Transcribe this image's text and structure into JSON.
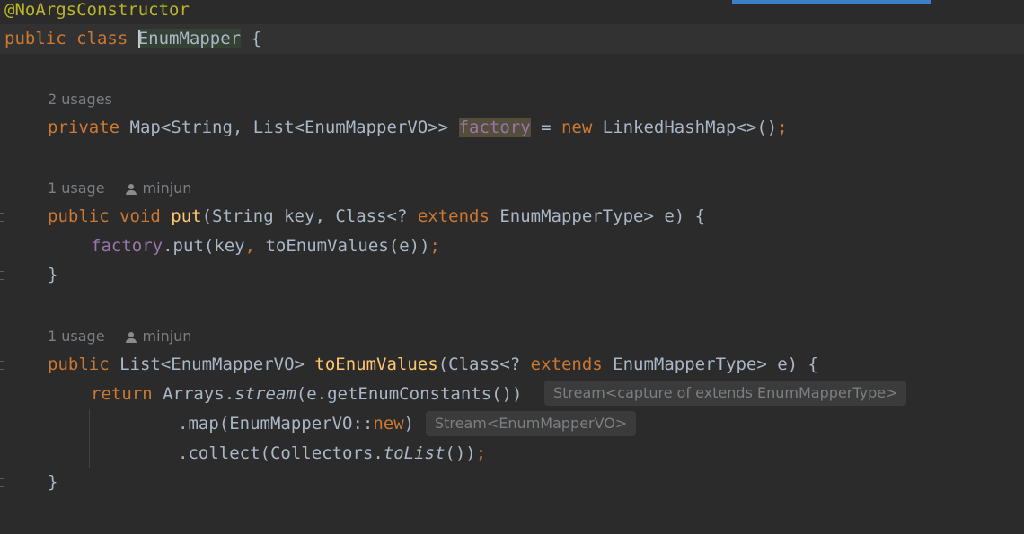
{
  "editor": {
    "colors": {
      "background": "#2b2b2b",
      "text": "#a9b7c6",
      "keyword": "#cc7832",
      "annotation": "#bbb529",
      "field": "#9876aa",
      "method": "#ffc66d",
      "hint": "#7c7f82"
    },
    "annotation": "@NoArgsConstructor",
    "class_decl": {
      "kw": "public class ",
      "name": "EnumMapper",
      "brace": " {"
    },
    "field_usage": "2 usages",
    "field_decl": {
      "kw1": "private ",
      "type": "Map<String, List<EnumMapperVO>> ",
      "name": "factory",
      "assign": " = ",
      "kw2": "new ",
      "rest": "LinkedHashMap<>()",
      "semi": ";"
    },
    "put_usage": "1 usage",
    "put_author": "minjun",
    "put_sig": {
      "kw": "public void ",
      "name": "put",
      "args1": "(String key, Class<? ",
      "kw2": "extends",
      "args2": " EnumMapperType> e) {"
    },
    "put_body": {
      "field": "factory",
      "call": ".put(key",
      "comma": ",",
      "rest": " toEnumValues(e))",
      "semi": ";"
    },
    "put_close": "}",
    "to_usage": "1 usage",
    "to_author": "minjun",
    "to_sig": {
      "kw": "public ",
      "type": "List<EnumMapperVO> ",
      "name": "toEnumValues",
      "args1": "(Class<? ",
      "kw2": "extends",
      "args2": " EnumMapperType> e) {"
    },
    "return_line": {
      "kw": "return ",
      "obj": "Arrays.",
      "method": "stream",
      "rest": "(e.getEnumConstants())"
    },
    "return_hint": "Stream<capture of extends EnumMapperType>",
    "map_line": {
      "pre": ".map(EnumMapperVO::",
      "kw": "new",
      "post": ")"
    },
    "map_hint": "Stream<EnumMapperVO>",
    "collect_line": {
      "pre": ".collect(Collectors.",
      "method": "toList",
      "post": "())",
      "semi": ";"
    },
    "to_close": "}"
  }
}
